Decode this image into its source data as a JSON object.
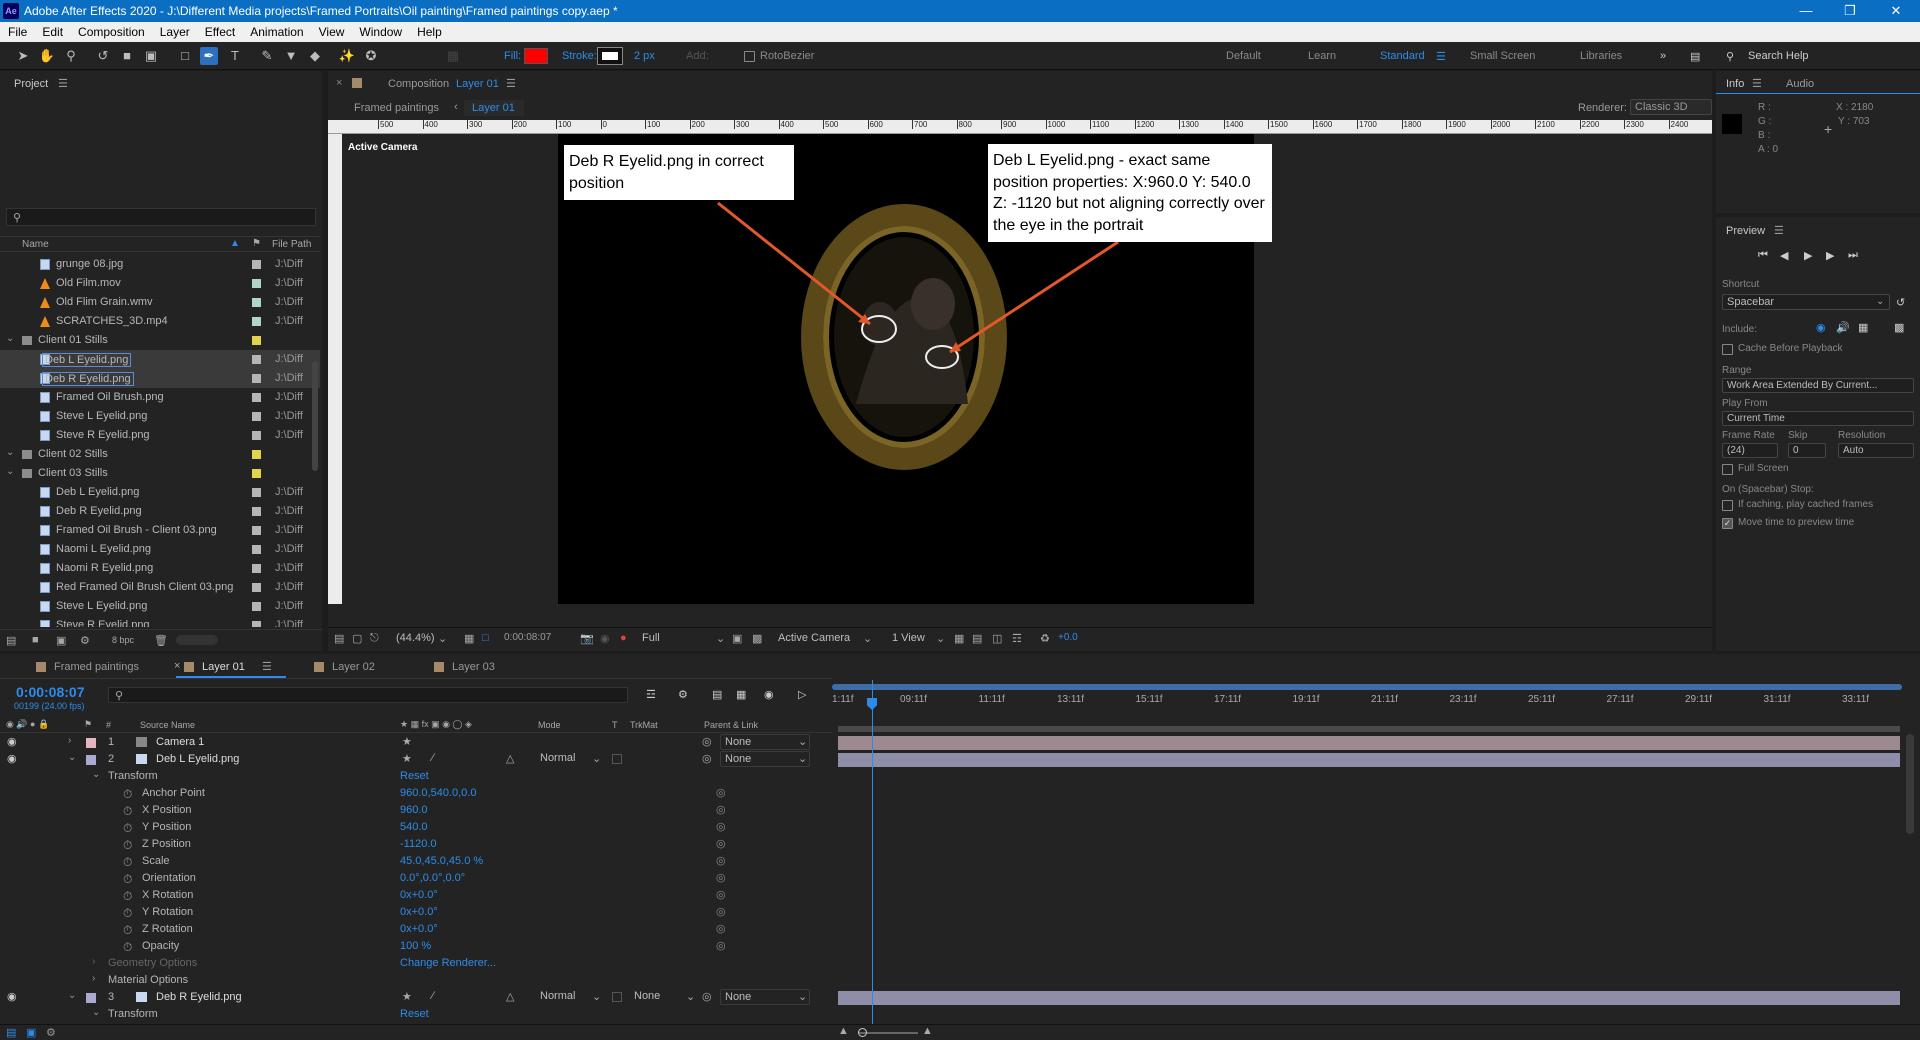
{
  "app": {
    "title": "Adobe After Effects 2020 - J:\\Different Media projects\\Framed Portraits\\Oil painting\\Framed paintings copy.aep *",
    "logo": "Ae"
  },
  "menu": [
    "File",
    "Edit",
    "Composition",
    "Layer",
    "Effect",
    "Animation",
    "View",
    "Window",
    "Help"
  ],
  "toolbar": {
    "fill_label": "Fill:",
    "fill_color": "#ff0000",
    "stroke_label": "Stroke:",
    "stroke_width": "2 px",
    "add_label": "Add:",
    "rotobezier": "RotoBezier",
    "workspaces": [
      "Default",
      "Learn",
      "Standard",
      "Small Screen",
      "Libraries"
    ],
    "active_workspace": "Standard",
    "search_placeholder": "Search Help"
  },
  "project": {
    "title": "Project",
    "search_placeholder": "",
    "col_name": "Name",
    "col_path": "File Path",
    "items": [
      {
        "name": "grunge 08.jpg",
        "type": "image",
        "color": "#b5b5b5",
        "path": "J:\\Diff",
        "indent": 1,
        "selected": false
      },
      {
        "name": "Old Film.mov",
        "type": "vlc",
        "color": "#b0d4c6",
        "path": "J:\\Diff",
        "indent": 1,
        "selected": false
      },
      {
        "name": "Old Flim Grain.wmv",
        "type": "vlc",
        "color": "#b0d4c6",
        "path": "J:\\Diff",
        "indent": 1,
        "selected": false
      },
      {
        "name": "SCRATCHES_3D.mp4",
        "type": "vlc",
        "color": "#b0d4c6",
        "path": "J:\\Diff",
        "indent": 1,
        "selected": false
      },
      {
        "name": "Client 01 Stills",
        "type": "folder",
        "color": "#e3d24f",
        "path": "",
        "indent": 0,
        "selected": false
      },
      {
        "name": "Deb L Eyelid.png",
        "type": "image",
        "color": "#b5b5b5",
        "path": "J:\\Diff",
        "indent": 1,
        "selected": true
      },
      {
        "name": "Deb R Eyelid.png",
        "type": "image",
        "color": "#b5b5b5",
        "path": "J:\\Diff",
        "indent": 1,
        "selected": true
      },
      {
        "name": "Framed Oil Brush.png",
        "type": "image",
        "color": "#b5b5b5",
        "path": "J:\\Diff",
        "indent": 1,
        "selected": false
      },
      {
        "name": "Steve L Eyelid.png",
        "type": "image",
        "color": "#b5b5b5",
        "path": "J:\\Diff",
        "indent": 1,
        "selected": false
      },
      {
        "name": "Steve R Eyelid.png",
        "type": "image",
        "color": "#b5b5b5",
        "path": "J:\\Diff",
        "indent": 1,
        "selected": false
      },
      {
        "name": "Client 02 Stills",
        "type": "folder",
        "color": "#e3d24f",
        "path": "",
        "indent": 0,
        "selected": false
      },
      {
        "name": "Client 03 Stills",
        "type": "folder",
        "color": "#e3d24f",
        "path": "",
        "indent": 0,
        "selected": false
      },
      {
        "name": "Deb L Eyelid.png",
        "type": "image",
        "color": "#b5b5b5",
        "path": "J:\\Diff",
        "indent": 1,
        "selected": false
      },
      {
        "name": "Deb R Eyelid.png",
        "type": "image",
        "color": "#b5b5b5",
        "path": "J:\\Diff",
        "indent": 1,
        "selected": false
      },
      {
        "name": "Framed Oil Brush - Client 03.png",
        "type": "image",
        "color": "#b5b5b5",
        "path": "J:\\Diff",
        "indent": 1,
        "selected": false
      },
      {
        "name": "Naomi L Eyelid.png",
        "type": "image",
        "color": "#b5b5b5",
        "path": "J:\\Diff",
        "indent": 1,
        "selected": false
      },
      {
        "name": "Naomi R Eyelid.png",
        "type": "image",
        "color": "#b5b5b5",
        "path": "J:\\Diff",
        "indent": 1,
        "selected": false
      },
      {
        "name": "Red Framed Oil Brush Client 03.png",
        "type": "image",
        "color": "#b5b5b5",
        "path": "J:\\Diff",
        "indent": 1,
        "selected": false
      },
      {
        "name": "Steve L Eyelid.png",
        "type": "image",
        "color": "#b5b5b5",
        "path": "J:\\Diff",
        "indent": 1,
        "selected": false
      },
      {
        "name": "Steve R Eyelid.png",
        "type": "image",
        "color": "#b5b5b5",
        "path": "J:\\Diff",
        "indent": 1,
        "selected": false
      }
    ],
    "bpc": "8 bpc"
  },
  "composition": {
    "panel_label": "Composition",
    "comp_name": "Layer 01",
    "breadcrumb_parent": "Framed paintings",
    "breadcrumb_child": "Layer 01",
    "renderer_label": "Renderer:",
    "renderer_value": "Classic 3D",
    "view_label": "Active Camera",
    "ruler_labels": [
      "500",
      "400",
      "300",
      "200",
      "100",
      "0",
      "100",
      "200",
      "300",
      "400",
      "500",
      "600",
      "700",
      "800",
      "900",
      "1000",
      "1100",
      "1200",
      "1300",
      "1400",
      "1500",
      "1600",
      "1700",
      "1800",
      "1900",
      "2000",
      "2100",
      "2200",
      "2300",
      "2400"
    ],
    "annotation_right": "Deb L Eyelid.png - exact same position properties: X:960.0  Y: 540.0  Z:  -1120 but not aligning correctly over the eye in the portrait",
    "annotation_left": "Deb R Eyelid.png in correct position",
    "zoom": "(44.4%)",
    "timecode": "0:00:08:07",
    "resolution": "Full",
    "camera": "Active Camera",
    "views": "1 View",
    "exposure": "+0.0"
  },
  "info": {
    "tab_info": "Info",
    "tab_audio": "Audio",
    "r": "R :",
    "g": "G :",
    "b": "B :",
    "a": "A :  0",
    "x": "X : 2180",
    "y": "Y : 703"
  },
  "preview": {
    "title": "Preview",
    "shortcut_label": "Shortcut",
    "shortcut_value": "Spacebar",
    "include_label": "Include:",
    "cache_label": "Cache Before Playback",
    "range_label": "Range",
    "range_value": "Work Area Extended By Current...",
    "play_from_label": "Play From",
    "play_from_value": "Current Time",
    "frame_rate_label": "Frame Rate",
    "skip_label": "Skip",
    "resolution_label": "Resolution",
    "frame_rate_value": "(24)",
    "skip_value": "0",
    "resolution_value": "Auto",
    "full_screen_label": "Full Screen",
    "stop_label": "On (Spacebar) Stop:",
    "if_caching_label": "If caching, play cached frames",
    "move_time_label": "Move time to preview time",
    "move_time_checked": true
  },
  "timeline": {
    "tabs": [
      {
        "label": "Framed paintings",
        "color": "#a58a6a",
        "active": false
      },
      {
        "label": "Layer 01",
        "color": "#a58a6a",
        "active": true
      },
      {
        "label": "Layer 02",
        "color": "#a58a6a",
        "active": false
      },
      {
        "label": "Layer 03",
        "color": "#a58a6a",
        "active": false
      }
    ],
    "timecode": "0:00:08:07",
    "frames": "00199 (24.00 fps)",
    "col_source": "Source Name",
    "col_mode": "Mode",
    "col_t": "T",
    "col_trkmat": "TrkMat",
    "col_parent": "Parent & Link",
    "ruler": [
      "1:11f",
      "09:11f",
      "11:11f",
      "13:11f",
      "15:11f",
      "17:11f",
      "19:11f",
      "21:11f",
      "23:11f",
      "25:11f",
      "27:11f",
      "29:11f",
      "31:11f",
      "33:11f"
    ],
    "layers": [
      {
        "num": "1",
        "name": "Camera 1",
        "color": "#e4b5c1",
        "mode": "",
        "trkmat": "",
        "parent": "None",
        "bar": "#9d8a90"
      },
      {
        "num": "2",
        "name": "Deb L Eyelid.png",
        "color": "#a9a9d2",
        "mode": "Normal",
        "trkmat": "",
        "parent": "None",
        "bar": "#8e8ea8"
      },
      {
        "num": "3",
        "name": "Deb R Eyelid.png",
        "color": "#a9a9d2",
        "mode": "Normal",
        "trkmat": "None",
        "parent": "None",
        "bar": "#8e8ea8"
      }
    ],
    "transform_label": "Transform",
    "reset_label": "Reset",
    "properties": [
      {
        "name": "Anchor Point",
        "value": "960.0,540.0,0.0"
      },
      {
        "name": "X Position",
        "value": "960.0"
      },
      {
        "name": "Y Position",
        "value": "540.0"
      },
      {
        "name": "Z Position",
        "value": "-1120.0"
      },
      {
        "name": "Scale",
        "value": "45.0,45.0,45.0 %"
      },
      {
        "name": "Orientation",
        "value": "0.0°,0.0°,0.0°"
      },
      {
        "name": "X Rotation",
        "value": "0x+0.0°"
      },
      {
        "name": "Y Rotation",
        "value": "0x+0.0°"
      },
      {
        "name": "Z Rotation",
        "value": "0x+0.0°"
      },
      {
        "name": "Opacity",
        "value": "100 %"
      }
    ],
    "geometry_label": "Geometry Options",
    "change_renderer": "Change Renderer...",
    "material_label": "Material Options",
    "transform_label_2": "Transform",
    "reset_label_2": "Reset"
  },
  "colors": {
    "accent": "#2d8ceb",
    "title_bar": "#0a6fc2"
  }
}
